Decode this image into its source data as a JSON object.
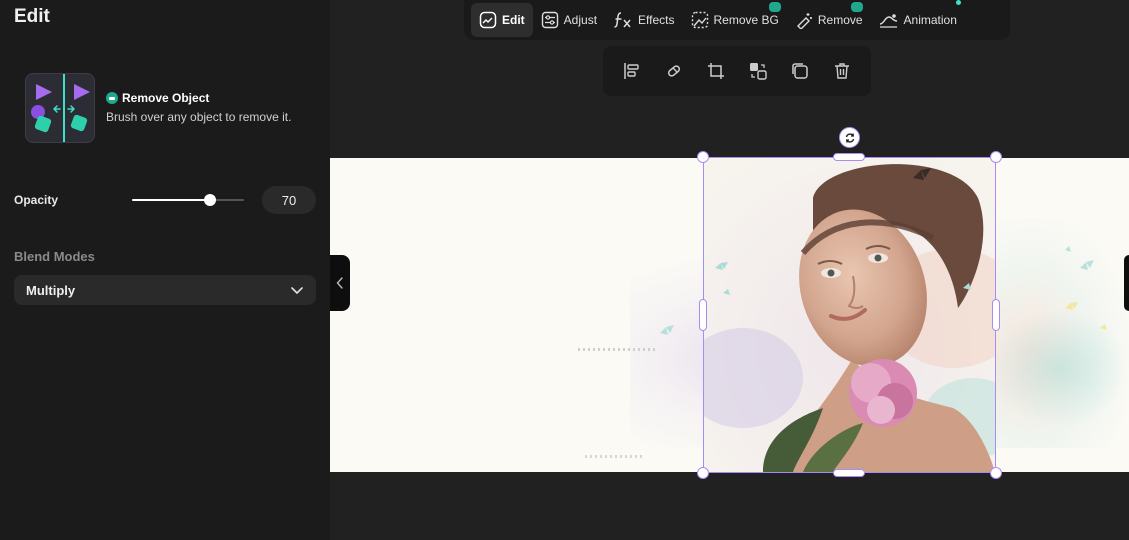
{
  "panel": {
    "title": "Edit",
    "feature": {
      "name": "Remove Object",
      "description": "Brush over any object to remove it."
    },
    "opacity": {
      "label": "Opacity",
      "value": "70",
      "fraction": 0.7
    },
    "blend": {
      "label": "Blend Modes",
      "selected": "Multiply"
    }
  },
  "toolbar": {
    "items": [
      {
        "label": "Edit",
        "icon": "edit-image-icon",
        "active": true
      },
      {
        "label": "Adjust",
        "icon": "adjust-sliders-icon",
        "active": false
      },
      {
        "label": "Effects",
        "icon": "fx-icon",
        "active": false
      },
      {
        "label": "Remove BG",
        "icon": "remove-bg-icon",
        "active": false,
        "pro": true
      },
      {
        "label": "Remove",
        "icon": "eraser-magic-icon",
        "active": false,
        "pro": true
      },
      {
        "label": "Animation",
        "icon": "animation-icon",
        "active": false,
        "new": true
      }
    ]
  },
  "object_toolbar": {
    "icons": [
      "align-icon",
      "eraser-icon",
      "crop-icon",
      "replace-icon",
      "duplicate-icon",
      "trash-icon"
    ]
  },
  "colors": {
    "accent": "#a98cf2",
    "pro_badge": "#1fa88e",
    "teal": "#3fe0c8",
    "purple": "#8b5cf6"
  }
}
